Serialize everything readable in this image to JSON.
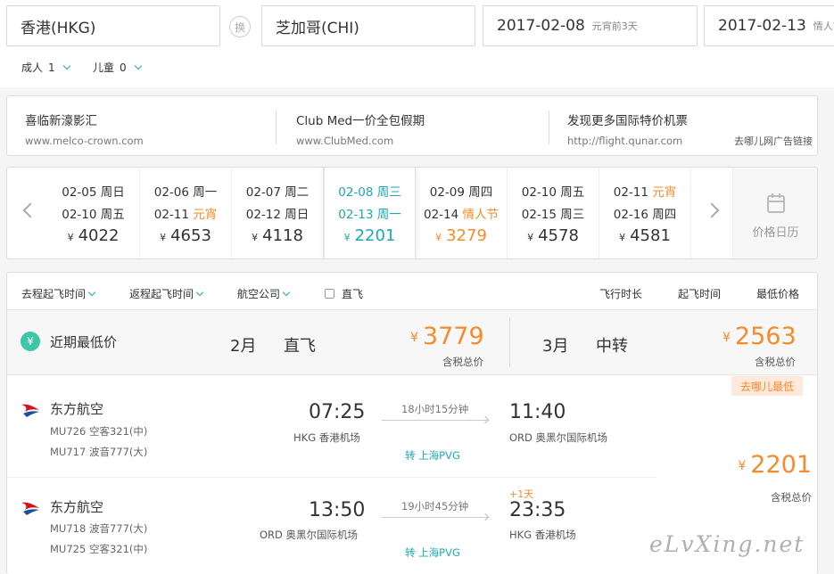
{
  "search": {
    "from": "香港(HKG)",
    "swap_label": "换",
    "to": "芝加哥(CHI)",
    "depart_date": "2017-02-08",
    "depart_note": "元宵前3天",
    "return_date": "2017-02-13",
    "return_note": "情人节"
  },
  "passengers": {
    "adult_label": "成人",
    "adult_count": "1",
    "child_label": "儿童",
    "child_count": "0"
  },
  "ads": [
    {
      "title": "喜临新濠影汇",
      "url": "www.melco-crown.com"
    },
    {
      "title": "Club Med一价全包假期",
      "url": "www.ClubMed.com"
    },
    {
      "title": "发现更多国际特价机票",
      "url": "http://flight.qunar.com"
    }
  ],
  "ad_link": "去哪儿网广告链接",
  "date_options": [
    {
      "dep_date": "02-05",
      "dep_day": "周日",
      "ret_date": "02-10",
      "ret_day": "周五",
      "price": "4022"
    },
    {
      "dep_date": "02-06",
      "dep_day": "周一",
      "ret_date": "02-11",
      "ret_day": "元宵",
      "price": "4653"
    },
    {
      "dep_date": "02-07",
      "dep_day": "周二",
      "ret_date": "02-12",
      "ret_day": "周日",
      "price": "4118"
    },
    {
      "dep_date": "02-08",
      "dep_day": "周三",
      "ret_date": "02-13",
      "ret_day": "周一",
      "price": "2201"
    },
    {
      "dep_date": "02-09",
      "dep_day": "周四",
      "ret_date": "02-14",
      "ret_day": "情人节",
      "price": "3279"
    },
    {
      "dep_date": "02-10",
      "dep_day": "周五",
      "ret_date": "02-15",
      "ret_day": "周三",
      "price": "4578"
    },
    {
      "dep_date": "02-11",
      "dep_day": "元宵",
      "ret_date": "02-16",
      "ret_day": "周四",
      "price": "4581"
    }
  ],
  "currency": "¥",
  "calendar_label": "价格日历",
  "filters": {
    "depart_time": "去程起飞时间",
    "return_time": "返程起飞时间",
    "airline": "航空公司",
    "direct": "直飞",
    "sort_duration": "飞行时长",
    "sort_depart": "起飞时间",
    "sort_price": "最低价格"
  },
  "lowest": {
    "label": "近期最低价",
    "direct_month": "2月",
    "direct_label": "直飞",
    "direct_price": "3779",
    "direct_tax": "含税总价",
    "transfer_month": "3月",
    "transfer_label": "中转",
    "transfer_price": "2563",
    "transfer_tax": "含税总价"
  },
  "badge": "去哪儿最低",
  "result": {
    "price": "2201",
    "tax": "含税总价",
    "outbound": {
      "airline": "东方航空",
      "flight1": "MU726 空客321(中)",
      "flight2": "MU717 波音777(大)",
      "dep_time": "07:25",
      "dep_airport": "HKG 香港机场",
      "duration": "18小时15分钟",
      "transfer": "转 上海PVG",
      "arr_time": "11:40",
      "arr_airport": "ORD 奥黑尔国际机场"
    },
    "inbound": {
      "airline": "东方航空",
      "flight1": "MU718 波音777(大)",
      "flight2": "MU725 空客321(中)",
      "dep_time": "13:50",
      "dep_airport": "ORD 奥黑尔国际机场",
      "duration": "19小时45分钟",
      "transfer": "转 上海PVG",
      "plus_day": "+1天",
      "arr_time": "23:35",
      "arr_airport": "HKG 香港机场"
    }
  },
  "watermark": "eLvXing.net",
  "colors": {
    "accent": "#1ba9ba",
    "price": "#f68b2a",
    "airline_red": "#d6121e",
    "airline_blue": "#1b4f9c"
  }
}
